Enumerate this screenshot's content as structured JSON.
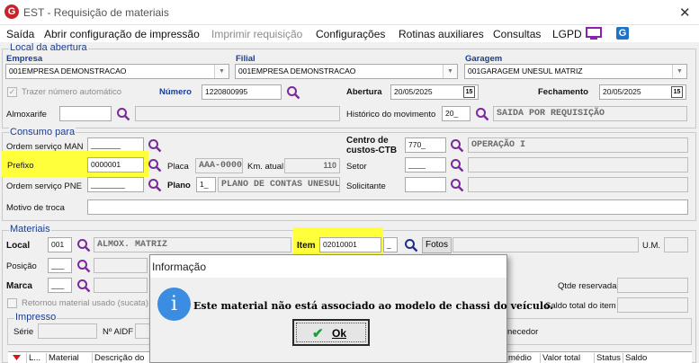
{
  "window": {
    "title": "EST - Requisição de materiais",
    "close": "✕"
  },
  "menu": {
    "items": [
      "Saída",
      "Abrir configuração de impressão",
      "Imprimir requisição",
      "Configurações",
      "Rotinas auxiliares",
      "Consultas",
      "LGPD"
    ]
  },
  "abertura": {
    "group_title": "Local da abertura",
    "empresa_label": "Empresa",
    "empresa_value": "001EMPRESA DEMONSTRACAO",
    "filial_label": "Filial",
    "filial_value": "001EMPRESA DEMONSTRACAO",
    "garagem_label": "Garagem",
    "garagem_value": "001GARAGEM UNESUL MATRIZ",
    "trazer_label": "Trazer número automático",
    "numero_label": "Número",
    "numero_value": "1220800995",
    "abertura_label": "Abertura",
    "abertura_value": "20/05/2025",
    "fechamento_label": "Fechamento",
    "fechamento_value": "20/05/2025",
    "almoxarife_label": "Almoxarife",
    "historico_label": "Histórico do movimento",
    "historico_code": "20_",
    "historico_desc": "SAIDA POR REQUISIÇÃO",
    "cal_btn": "15"
  },
  "consumo": {
    "group_title": "Consumo para",
    "os_man_label": "Ordem serviço MAN",
    "os_man_value": "_______",
    "prefixo_label": "Prefixo",
    "prefixo_value": "0000001",
    "placa_label": "Placa",
    "placa_value": "AAA-0000",
    "km_label": "Km. atual",
    "km_value": "110",
    "os_pne_label": "Ordem serviço PNE",
    "os_pne_value": "________",
    "plano_label": "Plano",
    "plano_code": "1_",
    "plano_desc": "PLANO DE CONTAS UNESUL",
    "motivo_label": "Motivo de troca",
    "centro_label_1": "Centro de",
    "centro_label_2": "custos-CTB",
    "centro_code": "770_",
    "centro_desc": "OPERAÇÃO I",
    "setor_label": "Setor",
    "setor_value": "____",
    "solicitante_label": "Solicitante"
  },
  "materiais": {
    "group_title": "Materiais",
    "local_label": "Local",
    "local_code": "001",
    "local_desc": "ALMOX. MATRIZ",
    "item_label": "Item",
    "item_value": "02010001",
    "fotos_label": "Fotos",
    "um_label": "U.M.",
    "posicao_label": "Posição",
    "posicao_value": "___",
    "marca_label": "Marca",
    "marca_value": "___",
    "retornou_label": "Retornou material usado (sucata)",
    "qtde_reservada_label": "Qtde reservada",
    "saldo_total_label": "Saldo total do item"
  },
  "impresso": {
    "group_title": "Impresso",
    "serie_label": "Série",
    "naidf_label": "Nº AIDF",
    "fornecedor_label": "necedor"
  },
  "grid": {
    "columns": [
      "L...",
      "Material",
      "Descrição do",
      "médio",
      "Valor total",
      "Status",
      "Saldo"
    ]
  },
  "dialog": {
    "title": "Informação",
    "icon": "i",
    "message": "Este material não está associado ao modelo de chassi do veículo.",
    "ok_label": "Ok"
  },
  "colors": {
    "highlight": "#ffff3c",
    "group_title": "#1a3d8f",
    "search_icon": "#7a2a9a",
    "info_icon": "#3a8de0"
  }
}
